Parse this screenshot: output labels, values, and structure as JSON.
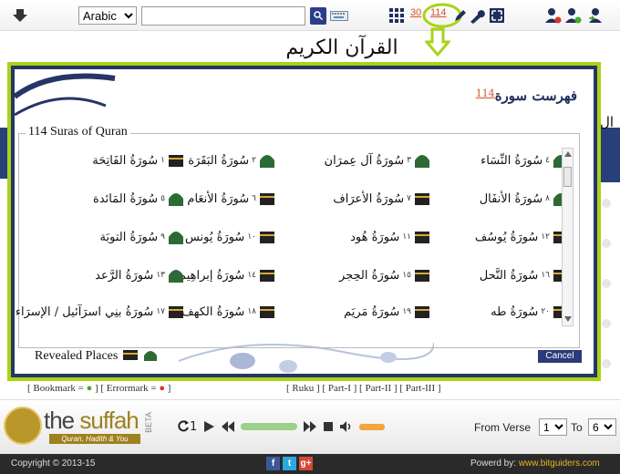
{
  "toolbar": {
    "language": "Arabic",
    "search_placeholder": "",
    "search_icon": "search-icon",
    "count_a": "30",
    "count_b": "114"
  },
  "page": {
    "title": "القرآن الكريم",
    "right_cut_text": "ال"
  },
  "modal": {
    "header_title": "فهرست سورة",
    "header_count": "114",
    "legend": "114 Suras of Quran",
    "revealed_label": "Revealed Places",
    "cancel_label": "Cancel",
    "suras": [
      {
        "num": "٤",
        "name": "سُورَةُ النِّسَاء",
        "place": "madina"
      },
      {
        "num": "٣",
        "name": "سُورَةُ آل عِمرَان",
        "place": "madina"
      },
      {
        "num": "٢",
        "name": "سُورَةُ البَقَرَة",
        "place": "madina"
      },
      {
        "num": "١",
        "name": "سُورَةُ الفَاتِحَة",
        "place": "makka"
      },
      {
        "num": "٨",
        "name": "سُورَةُ الأنفَال",
        "place": "madina"
      },
      {
        "num": "٧",
        "name": "سُورَةُ الأعرَاف",
        "place": "makka"
      },
      {
        "num": "٦",
        "name": "سُورَةُ الأنعَام",
        "place": "makka"
      },
      {
        "num": "٥",
        "name": "سُورَةُ المَائدة",
        "place": "madina"
      },
      {
        "num": "١٢",
        "name": "سُورَةُ يُوسُف",
        "place": "makka"
      },
      {
        "num": "١١",
        "name": "سُورَةُ هُود",
        "place": "makka"
      },
      {
        "num": "١٠",
        "name": "سُورَةُ يُونس",
        "place": "makka"
      },
      {
        "num": "٩",
        "name": "سُورَةُ التوبَة",
        "place": "madina"
      },
      {
        "num": "١٦",
        "name": "سُورَةُ النَّحل",
        "place": "makka"
      },
      {
        "num": "١٥",
        "name": "سُورَةُ الحِجر",
        "place": "makka"
      },
      {
        "num": "١٤",
        "name": "سُورَةُ إبراهِيم",
        "place": "makka"
      },
      {
        "num": "١٣",
        "name": "سُورَةُ الرَّعد",
        "place": "madina"
      },
      {
        "num": "٢٠",
        "name": "سُورَةُ طه",
        "place": "makka"
      },
      {
        "num": "١٩",
        "name": "سُورَةُ مَريَم",
        "place": "makka"
      },
      {
        "num": "١٨",
        "name": "سُورَةُ الكهف",
        "place": "makka"
      },
      {
        "num": "١٧",
        "name": "سُورَةُ بنِي اسرَآئيل / الإسرَاء",
        "place": "makka"
      }
    ]
  },
  "bottom_strip": {
    "bookmark": "[ Bookmark =",
    "errormark": "[ Errormark =",
    "parts": "[ Ruku   ]   [ Part-I   ]   [ Part-II   ]   [ Part-III   ]"
  },
  "player": {
    "logo_main": "the",
    "logo_accent": "suffah",
    "logo_sub": "Quran, Hadith & You",
    "beta": "BETA",
    "repeat_count": "1",
    "from_verse_label": "From Verse",
    "from_verse": "1",
    "to_label": "To",
    "to_verse": "6",
    "progress_fraction": 0.0
  },
  "footer": {
    "copyright": "Copyright © 2013-15",
    "powered_prefix": "Powerd by: ",
    "powered_link": "www.bitguiders.com",
    "social": [
      "f",
      "t",
      "g+"
    ]
  }
}
